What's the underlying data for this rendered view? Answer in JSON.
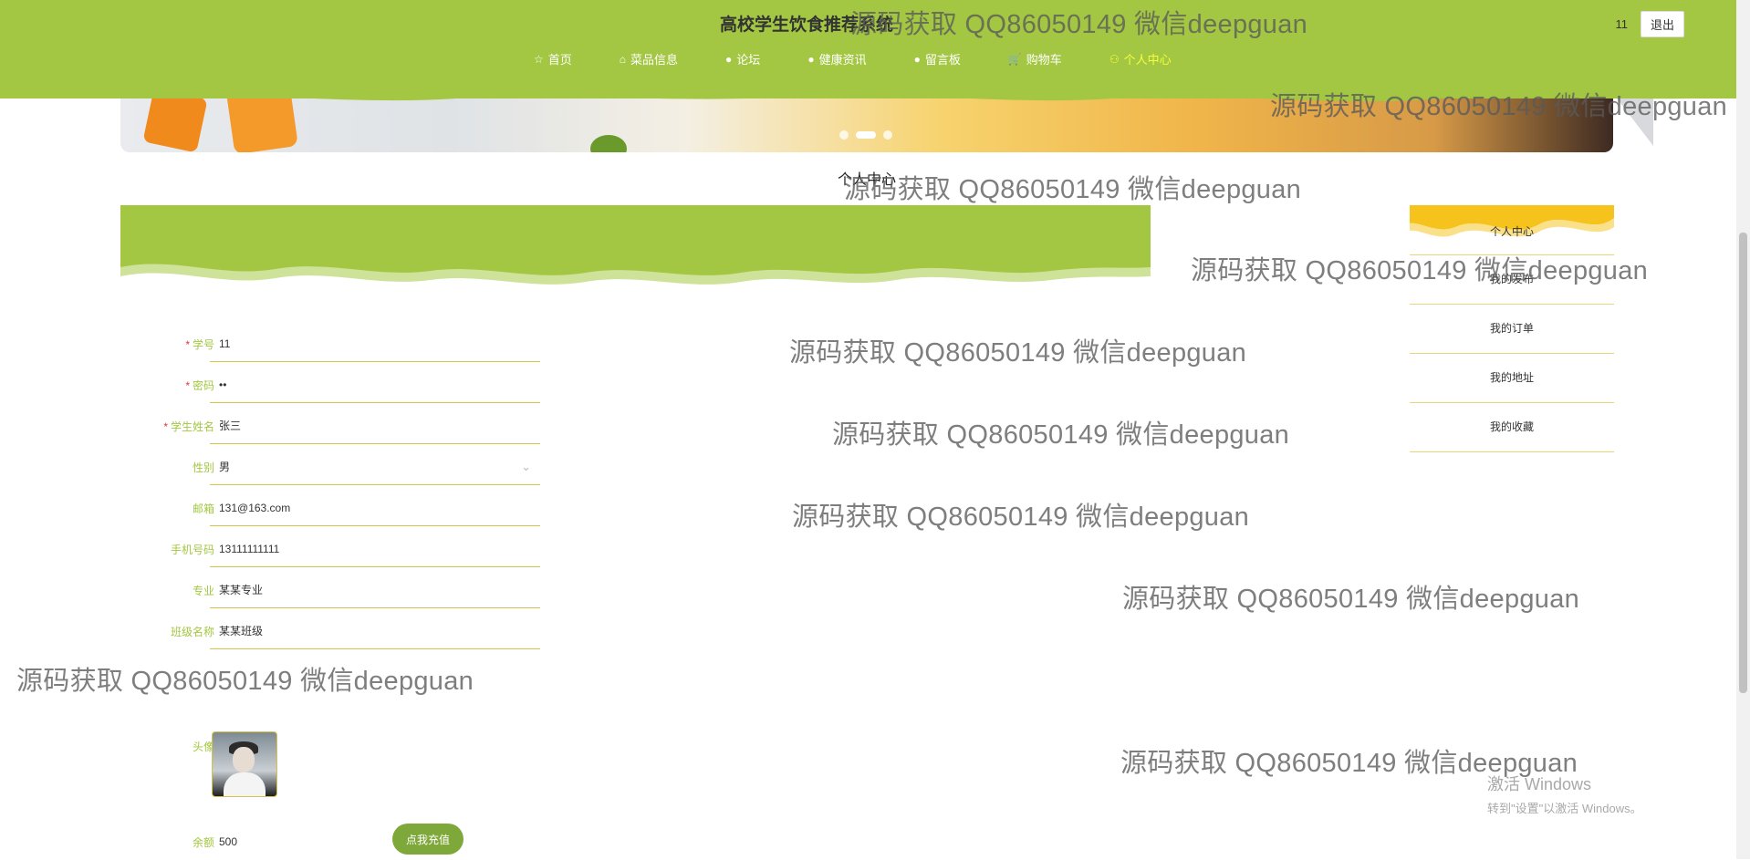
{
  "site": {
    "title": "高校学生饮食推荐系统"
  },
  "nav": [
    {
      "icon": "star-icon",
      "glyph": "☆",
      "label": "首页",
      "active": false
    },
    {
      "icon": "bag-icon",
      "glyph": "⌂",
      "label": "菜品信息",
      "active": false
    },
    {
      "icon": "dot-icon",
      "glyph": "●",
      "label": "论坛",
      "active": false
    },
    {
      "icon": "dot-icon",
      "glyph": "●",
      "label": "健康资讯",
      "active": false
    },
    {
      "icon": "info-icon",
      "glyph": "●",
      "label": "留言板",
      "active": false
    },
    {
      "icon": "cart-icon",
      "glyph": "🛒",
      "label": "购物车",
      "active": false
    },
    {
      "icon": "user-icon",
      "glyph": "⚇",
      "label": "个人中心",
      "active": true
    }
  ],
  "user": {
    "name": "11",
    "logout_label": "退出"
  },
  "section_title": "个人中心",
  "form": {
    "fields": [
      {
        "label": "学号",
        "required": true,
        "value": "11"
      },
      {
        "label": "密码",
        "required": true,
        "value": "••"
      },
      {
        "label": "学生姓名",
        "required": true,
        "value": "张三"
      },
      {
        "label": "性别",
        "required": false,
        "value": "男",
        "select": true
      },
      {
        "label": "邮箱",
        "required": false,
        "value": "131@163.com"
      },
      {
        "label": "手机号码",
        "required": false,
        "value": "13111111111"
      },
      {
        "label": "专业",
        "required": false,
        "value": "某某专业"
      },
      {
        "label": "班级名称",
        "required": false,
        "value": "某某班级"
      }
    ],
    "avatar_label": "头像",
    "balance_label": "余额",
    "balance_value": "500",
    "recharge_label": "点我充值"
  },
  "sidebar": {
    "items": [
      "个人中心",
      "我的发布",
      "我的订单",
      "我的地址",
      "我的收藏"
    ]
  },
  "watermark": "源码获取 QQ86050149 微信deepguan",
  "windows": {
    "line1": "激活 Windows",
    "line2": "转到\"设置\"以激活 Windows。"
  },
  "colors": {
    "primary": "#a3c742",
    "accent_yellow": "#f5c400",
    "active_nav": "#f5ff3a",
    "required": "#e0363c"
  }
}
